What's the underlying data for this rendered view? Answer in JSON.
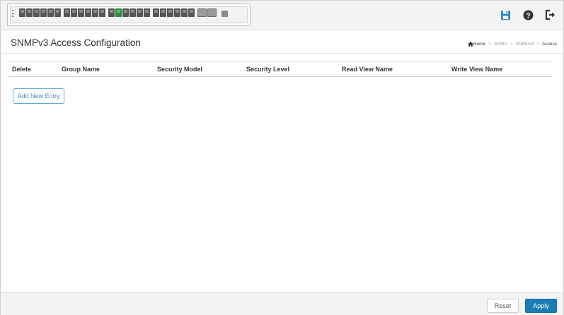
{
  "header": {
    "icons": [
      "save-icon",
      "help-icon",
      "logout-icon"
    ],
    "accent_color": "#1a7db5",
    "port_status": {
      "link_up_port_index": 13,
      "link_up_color": "#2e8b3f"
    }
  },
  "page": {
    "title": "SNMPv3 Access Configuration"
  },
  "breadcrumb": {
    "home": "Home",
    "items": [
      "SNMP",
      "SNMPv3",
      "Access"
    ],
    "separator": ">"
  },
  "table": {
    "columns": [
      "Delete",
      "Group Name",
      "Security Model",
      "Security Level",
      "Read View Name",
      "Write View Name"
    ],
    "rows": []
  },
  "actions": {
    "add_new_entry": "Add New Entry",
    "reset": "Reset",
    "apply": "Apply"
  }
}
